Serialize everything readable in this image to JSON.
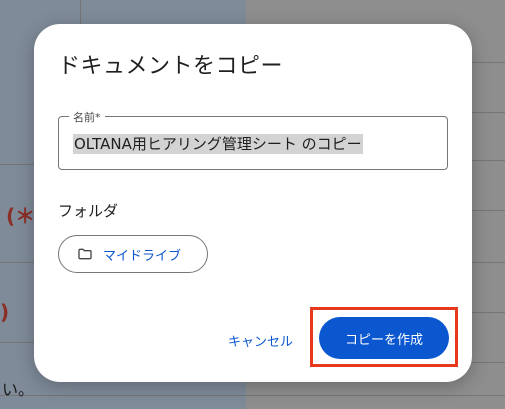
{
  "background": {
    "frag_left": "(＊",
    "frag_right": ")",
    "frag_bottom": "い。"
  },
  "dialog": {
    "title": "ドキュメントをコピー",
    "name_field": {
      "label": "名前*",
      "value": "OLTANA用ヒアリング管理シート のコピー"
    },
    "folder_label": "フォルダ",
    "folder_chip_label": "マイドライブ",
    "cancel_label": "キャンセル",
    "create_label": "コピーを作成"
  },
  "colors": {
    "primary": "#0b57d0",
    "highlight_box": "#e8391d"
  },
  "icons": {
    "folder": "folder-icon"
  }
}
